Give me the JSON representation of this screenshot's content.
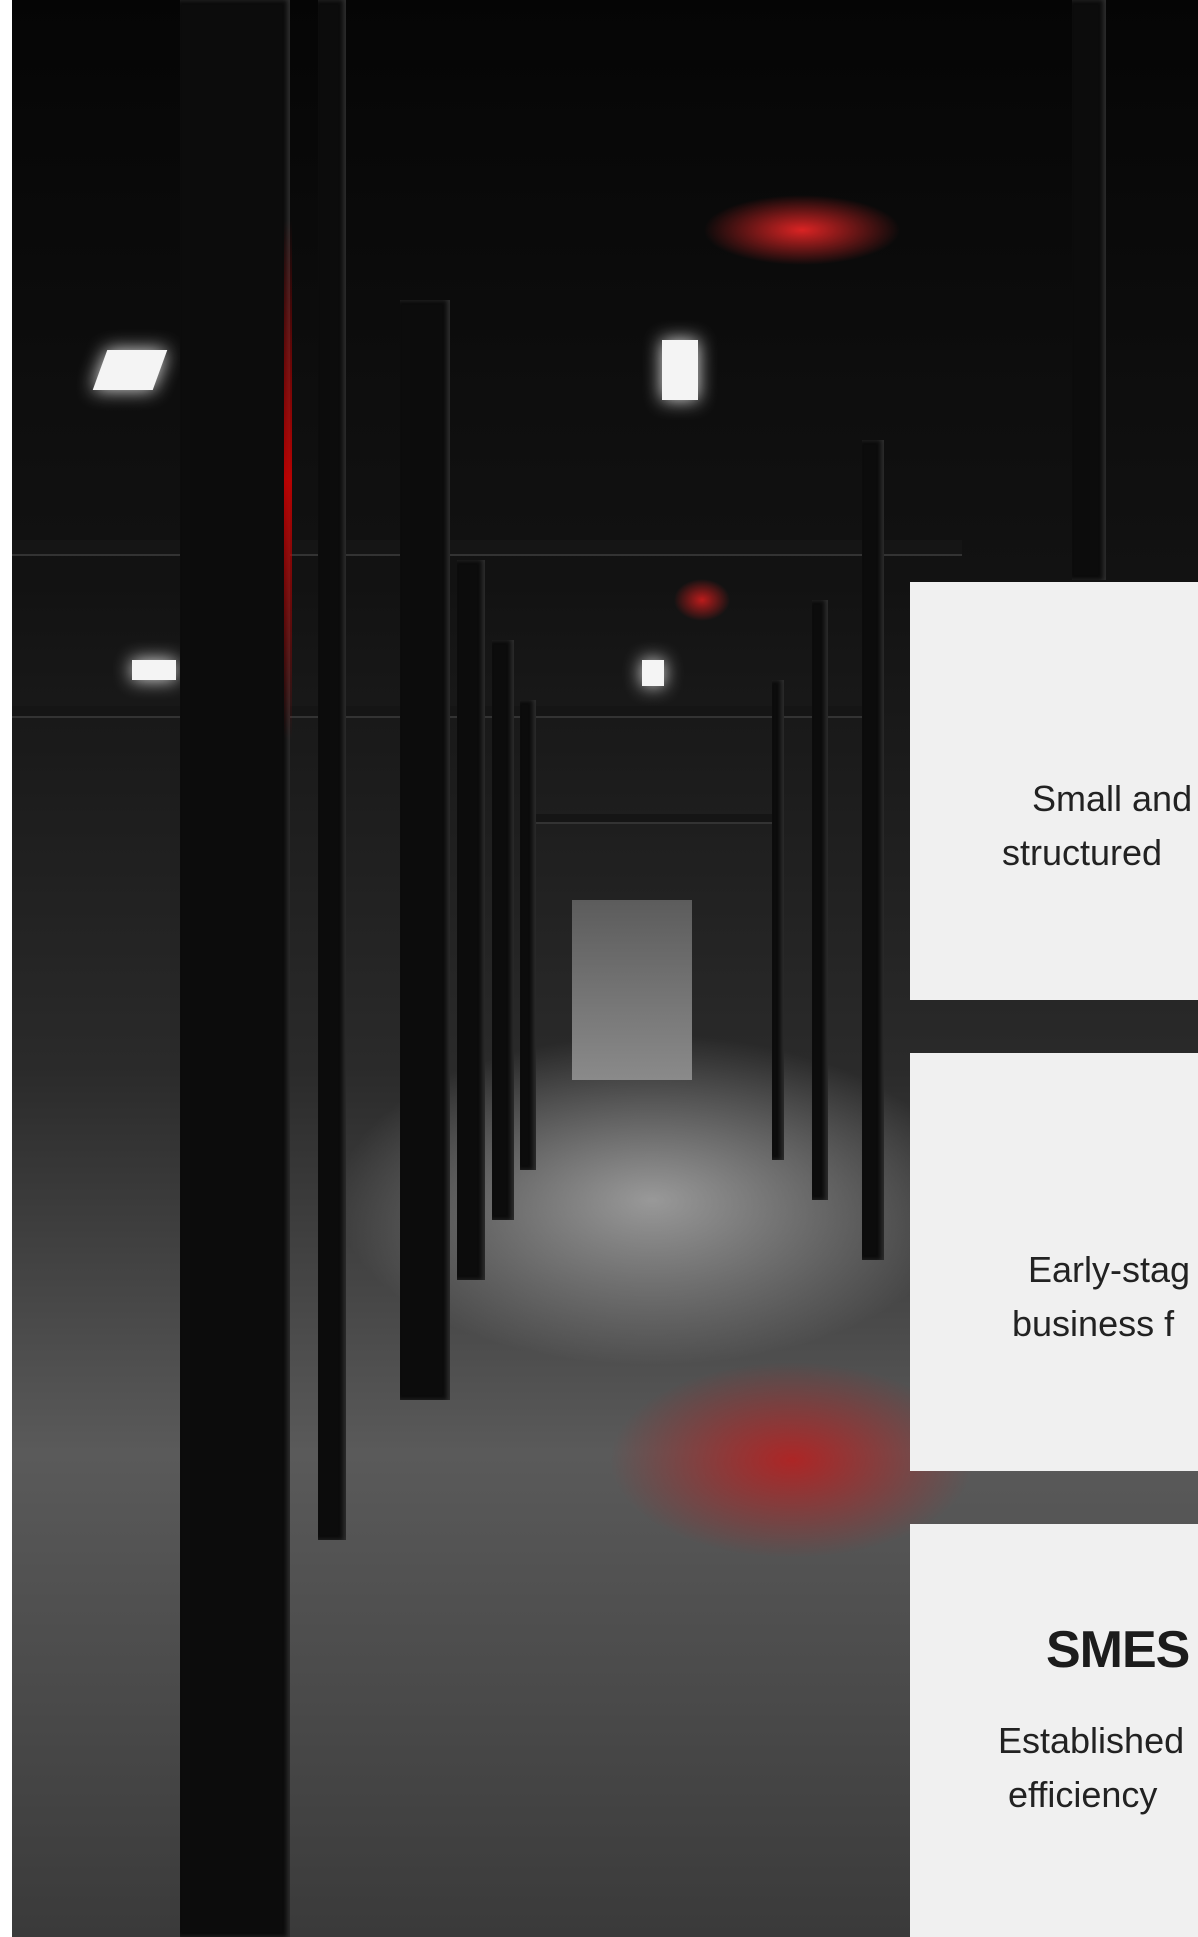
{
  "hero": {
    "image_icon": "industrial-corridor-photo",
    "accent_color": "#c41a1a"
  },
  "cards": [
    {
      "title": "",
      "description_lines": [
        "Small and",
        "structured"
      ]
    },
    {
      "title": "",
      "description_lines": [
        "Early-stag",
        "business f"
      ]
    },
    {
      "title": "SMES",
      "description_lines": [
        "Established",
        "efficiency"
      ]
    }
  ]
}
